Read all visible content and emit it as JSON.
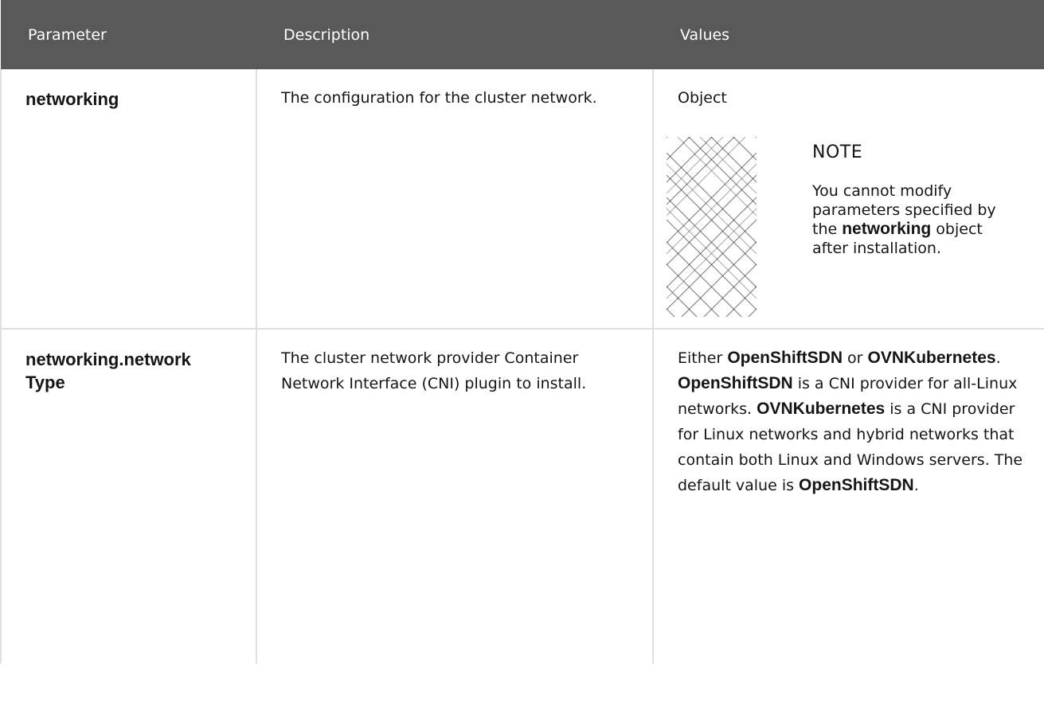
{
  "table": {
    "headers": [
      "Parameter",
      "Description",
      "Values"
    ],
    "rows": [
      {
        "parameter": "networking",
        "description": "The configuration for the cluster network.",
        "value": "Object",
        "note": {
          "title": "NOTE",
          "text_before": "You cannot modify parameters specified by the ",
          "bold": "networking",
          "text_after": " object after installation.",
          "icon": "note-lattice-icon"
        }
      },
      {
        "parameter": "networking.networkType",
        "parameter_line1": "networking.network",
        "parameter_line2": "Type",
        "description": "The cluster network provider Container Network Interface (CNI) plugin to install.",
        "values_parts": {
          "p1": "Either ",
          "b1": "OpenShiftSDN",
          "p2": " or ",
          "b2": "OVNKubernetes",
          "p3": ". ",
          "b3": "OpenShiftSDN",
          "p4": " is a CNI provider for all-Linux networks. ",
          "b4": "OVNKubernetes",
          "p5": " is a CNI provider for Linux networks and hybrid networks that contain both Linux and Windows servers. The default value is ",
          "b5": "OpenShiftSDN",
          "p6": "."
        }
      }
    ]
  },
  "colors": {
    "header_bg": "#595959",
    "header_text": "#ffffff",
    "border": "#e0e0e0",
    "text": "#151515"
  }
}
